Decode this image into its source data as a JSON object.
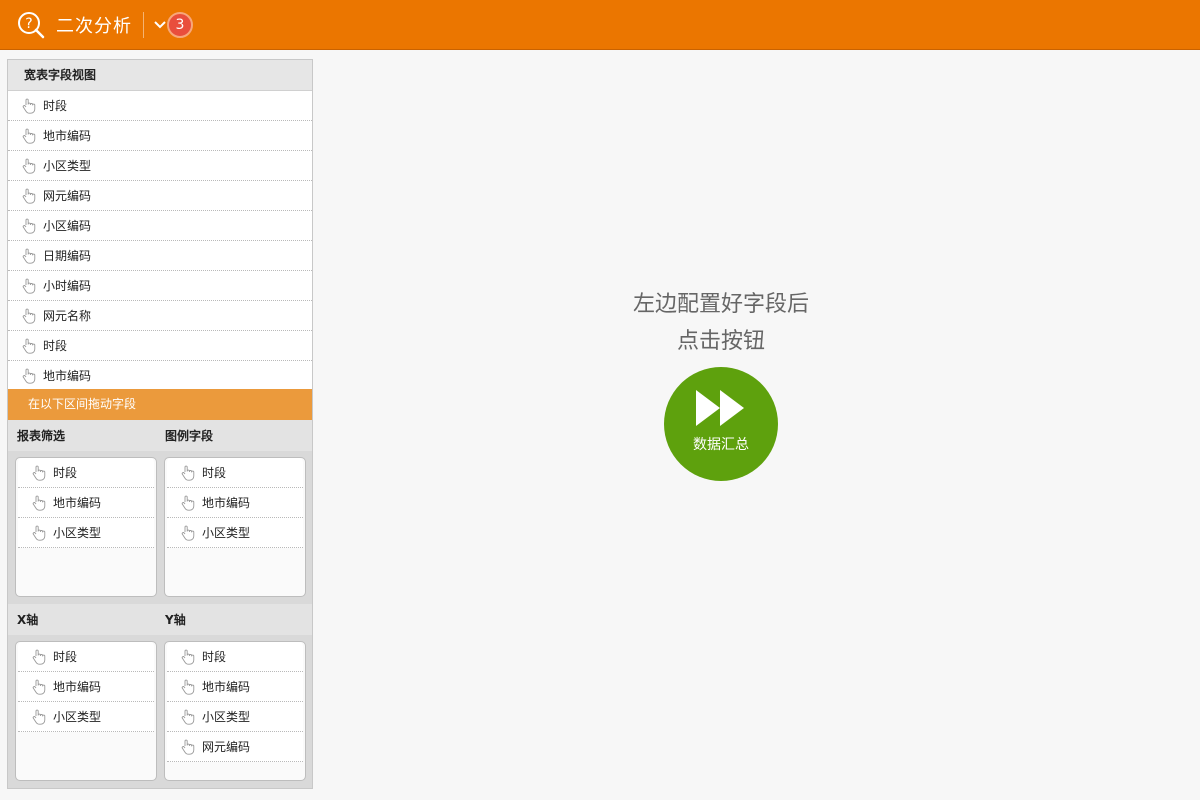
{
  "header": {
    "title": "二次分析",
    "badge_count": "3",
    "accent_color": "#eb7600"
  },
  "field_panel": {
    "title": "宽表字段视图",
    "fields": [
      "时段",
      "地市编码",
      "小区类型",
      "网元编码",
      "小区编码",
      "日期编码",
      "小时编码",
      "网元名称",
      "时段",
      "地市编码"
    ],
    "drag_hint": "在以下区间拖动字段"
  },
  "zones": {
    "report_filter": {
      "label": "报表筛选",
      "fields": [
        "时段",
        "地市编码",
        "小区类型"
      ]
    },
    "legend_field": {
      "label": "图例字段",
      "fields": [
        "时段",
        "地市编码",
        "小区类型"
      ]
    },
    "x_axis": {
      "label": "X轴",
      "fields": [
        "时段",
        "地市编码",
        "小区类型"
      ]
    },
    "y_axis": {
      "label": "Y轴",
      "fields": [
        "时段",
        "地市编码",
        "小区类型",
        "网元编码"
      ]
    }
  },
  "main": {
    "hint_line1": "左边配置好字段后",
    "hint_line2": "点击按钮",
    "button_label": "数据汇总",
    "button_color": "#5ea10d"
  }
}
